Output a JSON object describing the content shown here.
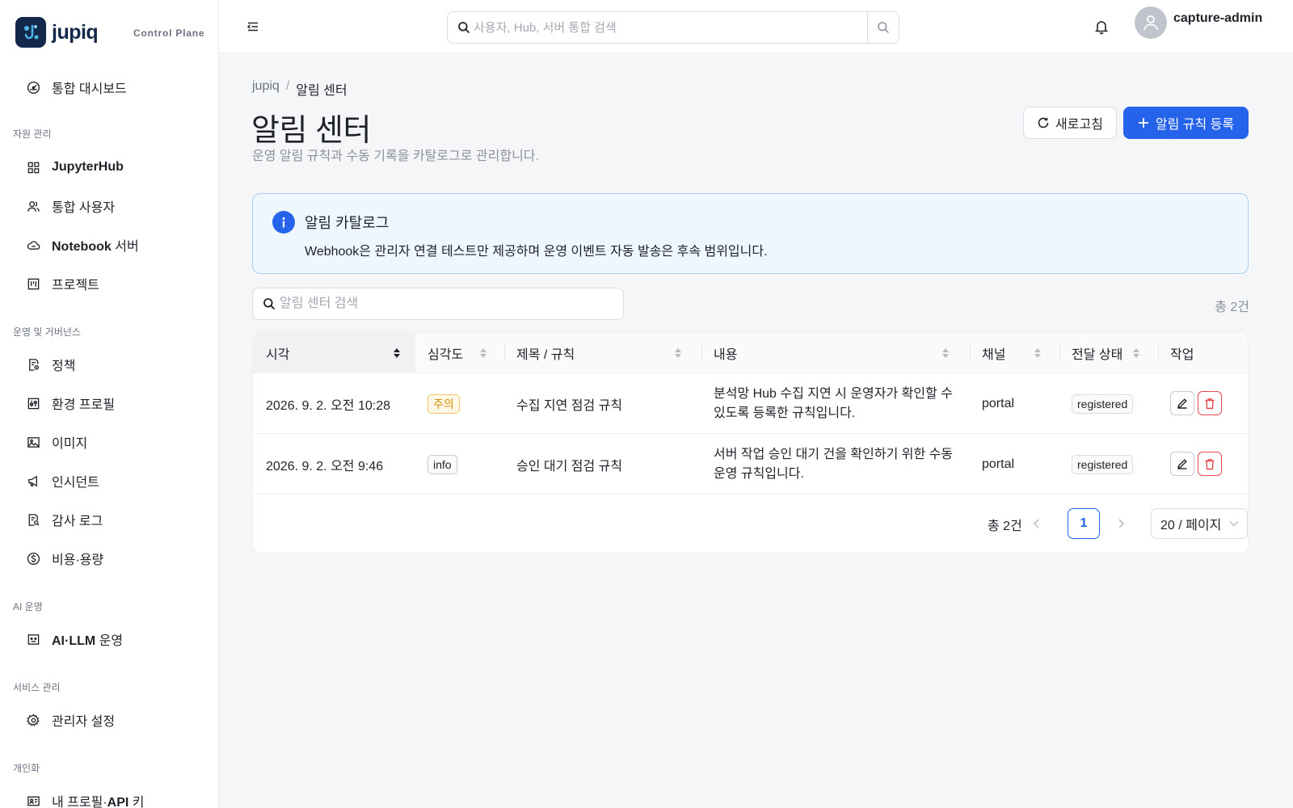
{
  "brand": {
    "name": "jupiq",
    "subtitle": "Control Plane"
  },
  "sidebar": {
    "sections": [
      {
        "label": "자원 관리"
      },
      {
        "label": "운영 및 거버넌스"
      },
      {
        "label": "AI 운영"
      },
      {
        "label": "서비스 관리"
      },
      {
        "label": "개인화"
      }
    ],
    "items": [
      {
        "label": "통합 대시보드",
        "icon": "dashboard-icon"
      },
      {
        "label": "JupyterHub",
        "icon": "grid-icon"
      },
      {
        "label": "통합 사용자",
        "icon": "users-icon"
      },
      {
        "label_bold": "Notebook",
        "label_rest": " 서버",
        "icon": "cloud-icon"
      },
      {
        "label": "프로젝트",
        "icon": "project-icon"
      },
      {
        "label": "정책",
        "icon": "policy-icon"
      },
      {
        "label": "환경 프로필",
        "icon": "sliders-icon"
      },
      {
        "label": "이미지",
        "icon": "image-icon"
      },
      {
        "label": "인시던트",
        "icon": "megaphone-icon"
      },
      {
        "label": "감사 로그",
        "icon": "audit-icon"
      },
      {
        "label": "비용·용량",
        "icon": "dollar-icon"
      },
      {
        "label_bold": "AI·LLM",
        "label_rest": " 운영",
        "icon": "robot-icon"
      },
      {
        "label": "관리자 설정",
        "icon": "gear-icon"
      },
      {
        "label_pre": "내 프로필·",
        "label_bold": "API",
        "label_rest": " 키",
        "icon": "id-card-icon"
      }
    ]
  },
  "topbar": {
    "search_placeholder": "사용자, Hub, 서버 통합 검색",
    "user_name": "capture-admin"
  },
  "breadcrumb": {
    "root": "jupiq",
    "sep": "/",
    "current": "알림 센터"
  },
  "page": {
    "title": "알림 센터",
    "subtitle": "운영 알림 규칙과 수동 기록을 카탈로그로 관리합니다.",
    "refresh_label": "새로고침",
    "add_label": "알림 규칙 등록"
  },
  "info": {
    "title": "알림 카탈로그",
    "text": "Webhook은 관리자 연결 테스트만 제공하며 운영 이벤트 자동 발송은 후속 범위입니다."
  },
  "table": {
    "search_placeholder": "알림 센터 검색",
    "total_top": "총 2건",
    "columns": [
      "시각",
      "심각도",
      "제목 / 규칙",
      "내용",
      "채널",
      "전달 상태",
      "작업"
    ],
    "rows": [
      {
        "time": "2026. 9. 2. 오전 10:28",
        "severity": "주의",
        "severity_kind": "warning",
        "title": "수집 지연 점검 규칙",
        "content": "분석망 Hub 수집 지연 시 운영자가 확인할 수 있도록 등록한 규칙입니다.",
        "channel": "portal",
        "status": "registered"
      },
      {
        "time": "2026. 9. 2. 오전 9:46",
        "severity": "info",
        "severity_kind": "info",
        "title": "승인 대기 점검 규칙",
        "content": "서버 작업 승인 대기 건을 확인하기 위한 수동 운영 규칙입니다.",
        "channel": "portal",
        "status": "registered"
      }
    ]
  },
  "pagination": {
    "total": "총 2건",
    "current_page": "1",
    "page_size": "20 / 페이지"
  },
  "colors": {
    "primary": "#2563eb",
    "danger": "#e5484d",
    "warning": "#d48806",
    "info_bg": "#eef6fe"
  }
}
